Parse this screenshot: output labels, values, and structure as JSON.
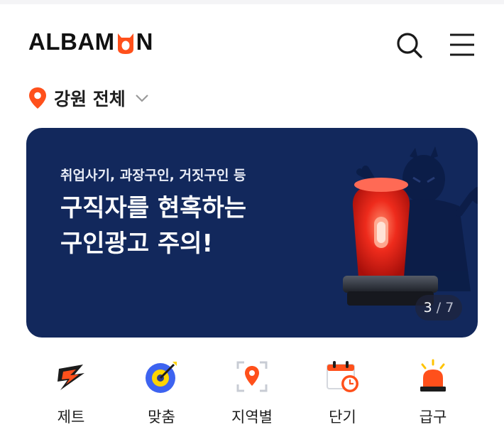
{
  "header": {
    "logo_text": "ALBAM",
    "logo_text_end": "N"
  },
  "region": {
    "label": "강원 전체"
  },
  "banner": {
    "subtitle": "취업사기, 과장구인, 거짓구인 등",
    "title_line1": "구직자를 현혹하는",
    "title_line2": "구인광고 주의!",
    "counter_current": "3",
    "counter_separator": " / ",
    "counter_total": "7"
  },
  "quick_menu": {
    "items": [
      {
        "label": "제트",
        "icon": "zet-icon"
      },
      {
        "label": "맞춤",
        "icon": "target-icon"
      },
      {
        "label": "지역별",
        "icon": "location-icon"
      },
      {
        "label": "단기",
        "icon": "calendar-clock-icon"
      },
      {
        "label": "급구",
        "icon": "siren-icon"
      }
    ]
  },
  "colors": {
    "brand_orange": "#ff501b",
    "banner_bg": "#12285c",
    "target_blue": "#3d63f0",
    "target_yellow": "#ffd400"
  }
}
